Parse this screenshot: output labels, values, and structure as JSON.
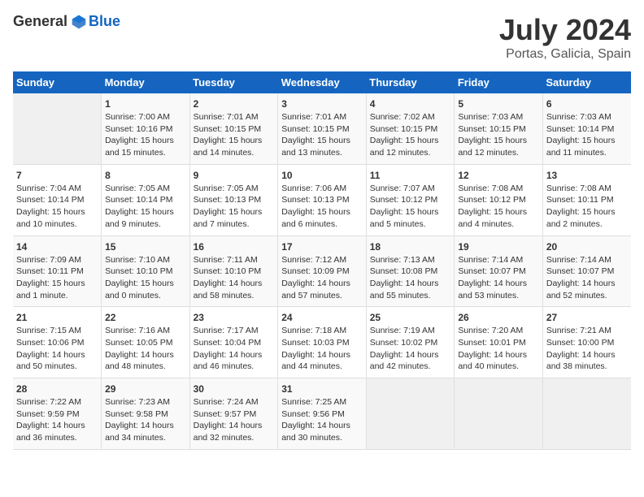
{
  "header": {
    "logo_general": "General",
    "logo_blue": "Blue",
    "title": "July 2024",
    "subtitle": "Portas, Galicia, Spain"
  },
  "calendar": {
    "days_of_week": [
      "Sunday",
      "Monday",
      "Tuesday",
      "Wednesday",
      "Thursday",
      "Friday",
      "Saturday"
    ],
    "weeks": [
      [
        {
          "day": "",
          "info": ""
        },
        {
          "day": "1",
          "info": "Sunrise: 7:00 AM\nSunset: 10:16 PM\nDaylight: 15 hours\nand 15 minutes."
        },
        {
          "day": "2",
          "info": "Sunrise: 7:01 AM\nSunset: 10:15 PM\nDaylight: 15 hours\nand 14 minutes."
        },
        {
          "day": "3",
          "info": "Sunrise: 7:01 AM\nSunset: 10:15 PM\nDaylight: 15 hours\nand 13 minutes."
        },
        {
          "day": "4",
          "info": "Sunrise: 7:02 AM\nSunset: 10:15 PM\nDaylight: 15 hours\nand 12 minutes."
        },
        {
          "day": "5",
          "info": "Sunrise: 7:03 AM\nSunset: 10:15 PM\nDaylight: 15 hours\nand 12 minutes."
        },
        {
          "day": "6",
          "info": "Sunrise: 7:03 AM\nSunset: 10:14 PM\nDaylight: 15 hours\nand 11 minutes."
        }
      ],
      [
        {
          "day": "7",
          "info": "Sunrise: 7:04 AM\nSunset: 10:14 PM\nDaylight: 15 hours\nand 10 minutes."
        },
        {
          "day": "8",
          "info": "Sunrise: 7:05 AM\nSunset: 10:14 PM\nDaylight: 15 hours\nand 9 minutes."
        },
        {
          "day": "9",
          "info": "Sunrise: 7:05 AM\nSunset: 10:13 PM\nDaylight: 15 hours\nand 7 minutes."
        },
        {
          "day": "10",
          "info": "Sunrise: 7:06 AM\nSunset: 10:13 PM\nDaylight: 15 hours\nand 6 minutes."
        },
        {
          "day": "11",
          "info": "Sunrise: 7:07 AM\nSunset: 10:12 PM\nDaylight: 15 hours\nand 5 minutes."
        },
        {
          "day": "12",
          "info": "Sunrise: 7:08 AM\nSunset: 10:12 PM\nDaylight: 15 hours\nand 4 minutes."
        },
        {
          "day": "13",
          "info": "Sunrise: 7:08 AM\nSunset: 10:11 PM\nDaylight: 15 hours\nand 2 minutes."
        }
      ],
      [
        {
          "day": "14",
          "info": "Sunrise: 7:09 AM\nSunset: 10:11 PM\nDaylight: 15 hours\nand 1 minute."
        },
        {
          "day": "15",
          "info": "Sunrise: 7:10 AM\nSunset: 10:10 PM\nDaylight: 15 hours\nand 0 minutes."
        },
        {
          "day": "16",
          "info": "Sunrise: 7:11 AM\nSunset: 10:10 PM\nDaylight: 14 hours\nand 58 minutes."
        },
        {
          "day": "17",
          "info": "Sunrise: 7:12 AM\nSunset: 10:09 PM\nDaylight: 14 hours\nand 57 minutes."
        },
        {
          "day": "18",
          "info": "Sunrise: 7:13 AM\nSunset: 10:08 PM\nDaylight: 14 hours\nand 55 minutes."
        },
        {
          "day": "19",
          "info": "Sunrise: 7:14 AM\nSunset: 10:07 PM\nDaylight: 14 hours\nand 53 minutes."
        },
        {
          "day": "20",
          "info": "Sunrise: 7:14 AM\nSunset: 10:07 PM\nDaylight: 14 hours\nand 52 minutes."
        }
      ],
      [
        {
          "day": "21",
          "info": "Sunrise: 7:15 AM\nSunset: 10:06 PM\nDaylight: 14 hours\nand 50 minutes."
        },
        {
          "day": "22",
          "info": "Sunrise: 7:16 AM\nSunset: 10:05 PM\nDaylight: 14 hours\nand 48 minutes."
        },
        {
          "day": "23",
          "info": "Sunrise: 7:17 AM\nSunset: 10:04 PM\nDaylight: 14 hours\nand 46 minutes."
        },
        {
          "day": "24",
          "info": "Sunrise: 7:18 AM\nSunset: 10:03 PM\nDaylight: 14 hours\nand 44 minutes."
        },
        {
          "day": "25",
          "info": "Sunrise: 7:19 AM\nSunset: 10:02 PM\nDaylight: 14 hours\nand 42 minutes."
        },
        {
          "day": "26",
          "info": "Sunrise: 7:20 AM\nSunset: 10:01 PM\nDaylight: 14 hours\nand 40 minutes."
        },
        {
          "day": "27",
          "info": "Sunrise: 7:21 AM\nSunset: 10:00 PM\nDaylight: 14 hours\nand 38 minutes."
        }
      ],
      [
        {
          "day": "28",
          "info": "Sunrise: 7:22 AM\nSunset: 9:59 PM\nDaylight: 14 hours\nand 36 minutes."
        },
        {
          "day": "29",
          "info": "Sunrise: 7:23 AM\nSunset: 9:58 PM\nDaylight: 14 hours\nand 34 minutes."
        },
        {
          "day": "30",
          "info": "Sunrise: 7:24 AM\nSunset: 9:57 PM\nDaylight: 14 hours\nand 32 minutes."
        },
        {
          "day": "31",
          "info": "Sunrise: 7:25 AM\nSunset: 9:56 PM\nDaylight: 14 hours\nand 30 minutes."
        },
        {
          "day": "",
          "info": ""
        },
        {
          "day": "",
          "info": ""
        },
        {
          "day": "",
          "info": ""
        }
      ]
    ]
  }
}
